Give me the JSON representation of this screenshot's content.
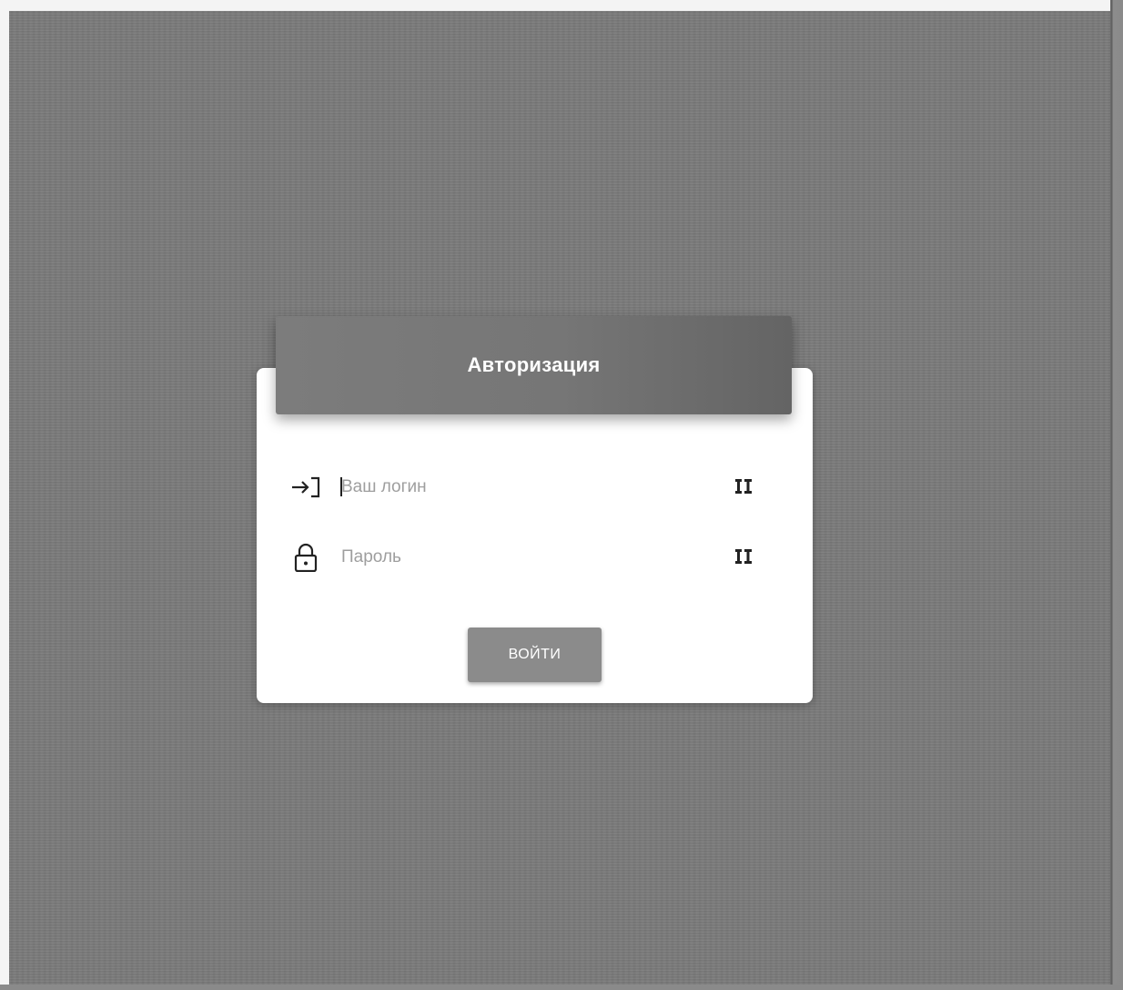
{
  "auth": {
    "title": "Авторизация",
    "login": {
      "placeholder": "Ваш логин",
      "value": "",
      "icon": "login-arrow-icon",
      "action_icon": "key-icon"
    },
    "password": {
      "placeholder": "Пароль",
      "value": "",
      "icon": "lock-icon",
      "action_icon": "key-icon"
    },
    "submit_label": "ВОЙТИ"
  },
  "colors": {
    "background": "#7a7a7a",
    "header": "#767676",
    "button": "#8b8b8b",
    "card": "#ffffff"
  }
}
